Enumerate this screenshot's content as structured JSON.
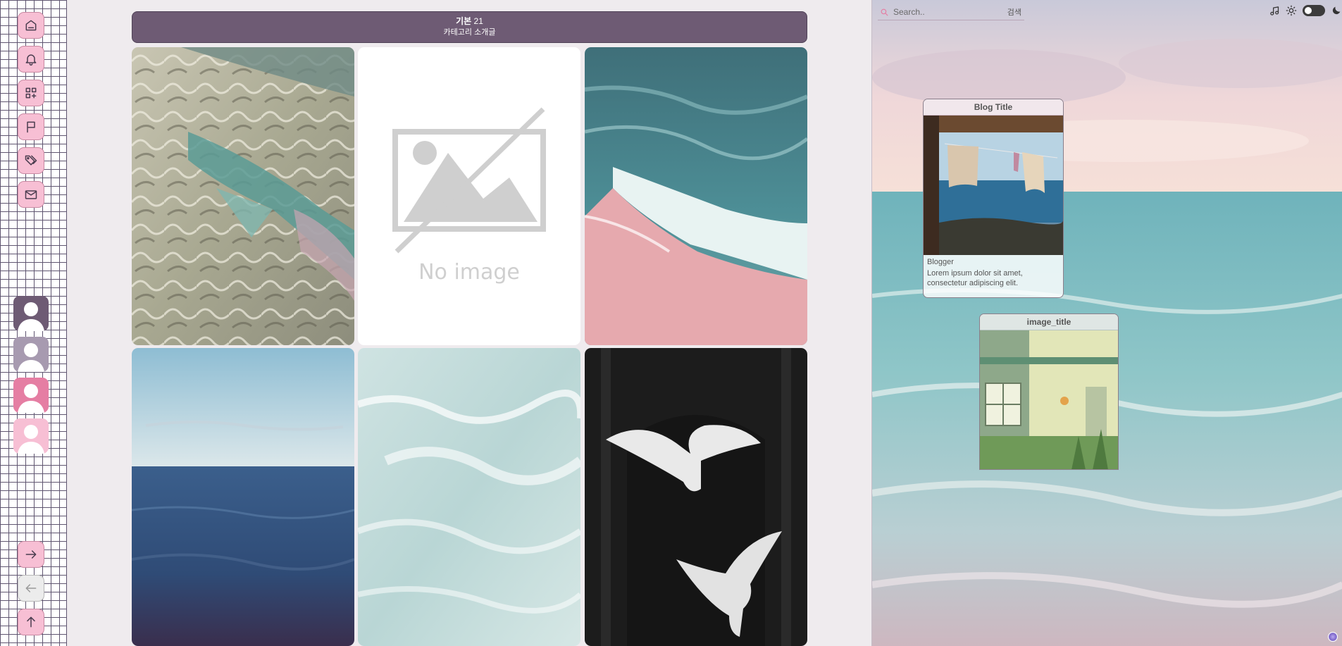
{
  "header": {
    "category": "기본",
    "count": "21",
    "subtitle": "카테고리 소개글"
  },
  "tiles": {
    "no_image_label": "No image"
  },
  "search": {
    "placeholder": "Search..",
    "button": "검색"
  },
  "cards": [
    {
      "title": "Blog Title",
      "author": "Blogger",
      "description": "Lorem ipsum dolor sit amet, consectetur adipiscing elit."
    },
    {
      "title": "image_title"
    }
  ],
  "nav": {
    "top": [
      "home-icon",
      "bell-icon",
      "grid-add-icon",
      "flag-icon",
      "tags-icon",
      "mail-icon"
    ],
    "avatars": [
      "#6e5b74",
      "#a79ab0",
      "#e57ea3",
      "#f7bfd4"
    ],
    "bottom": [
      "arrow-right-icon",
      "arrow-left-icon",
      "arrow-up-icon"
    ]
  },
  "colors": {
    "accent": "#6e5b74",
    "pink": "#f7bfd4",
    "background": "#efebee"
  }
}
